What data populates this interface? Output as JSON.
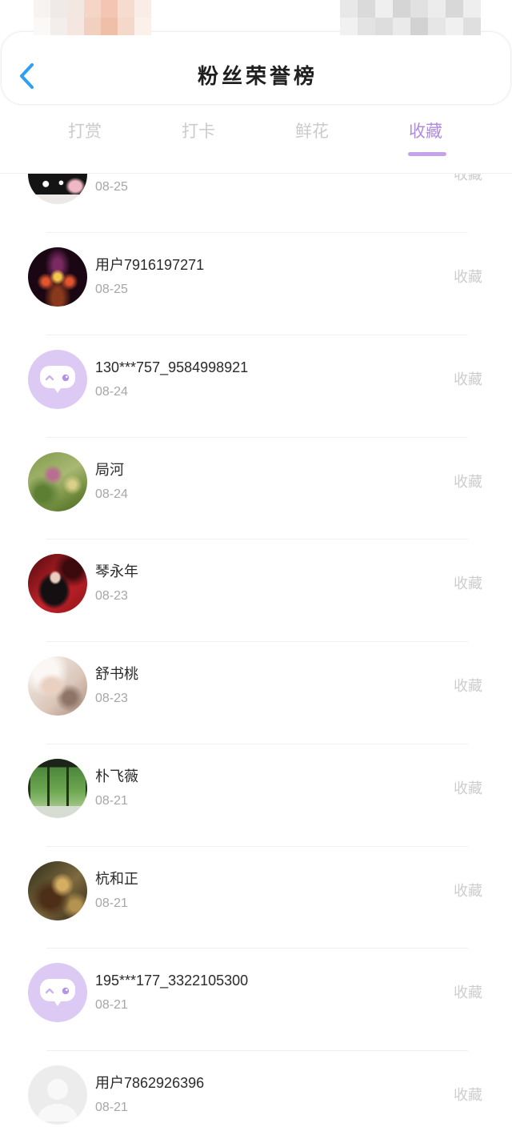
{
  "header": {
    "title": "粉丝荣誉榜",
    "back_icon": "chevron-left-icon"
  },
  "tabs": [
    {
      "label": "打赏",
      "active": false
    },
    {
      "label": "打卡",
      "active": false
    },
    {
      "label": "鲜花",
      "active": false
    },
    {
      "label": "收藏",
      "active": true
    }
  ],
  "list": {
    "items": [
      {
        "date": "08-25",
        "action": "收藏",
        "avatar": "cartoon-photo-avatar"
      },
      {
        "name": "用户7916197271",
        "date": "08-25",
        "action": "收藏",
        "avatar": "photo-avatar"
      },
      {
        "name": "130***757_9584998921",
        "date": "08-24",
        "action": "收藏",
        "avatar": "chat-bubble-avatar"
      },
      {
        "name": "局河",
        "date": "08-24",
        "action": "收藏",
        "avatar": "photo-avatar"
      },
      {
        "name": "琴永年",
        "date": "08-23",
        "action": "收藏",
        "avatar": "photo-avatar"
      },
      {
        "name": "舒书桃",
        "date": "08-23",
        "action": "收藏",
        "avatar": "photo-avatar"
      },
      {
        "name": "朴飞薇",
        "date": "08-21",
        "action": "收藏",
        "avatar": "photo-avatar"
      },
      {
        "name": "杭和正",
        "date": "08-21",
        "action": "收藏",
        "avatar": "photo-avatar"
      },
      {
        "name": "195***177_3322105300",
        "date": "08-21",
        "action": "收藏",
        "avatar": "chat-bubble-avatar"
      },
      {
        "name": "用户7862926396",
        "date": "08-21",
        "action": "收藏",
        "avatar": "default-user-avatar"
      }
    ]
  },
  "colors": {
    "back_arrow": "#2f9ff2",
    "tab_active": "#b08cdc",
    "tab_indicator": "#c5a3ec",
    "tab_inactive": "#cbcbcb"
  }
}
